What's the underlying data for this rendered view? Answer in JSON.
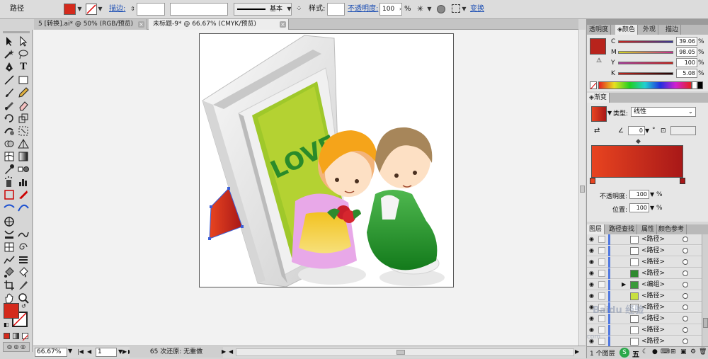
{
  "control_bar": {
    "object_type": "路径",
    "stroke_label": "描边:",
    "stroke_profile": "基本",
    "style_label": "样式:",
    "opacity_label": "不透明度:",
    "opacity_value": "100",
    "opacity_unit": "%",
    "transform_link": "变换",
    "fill_color": "#d42a1c"
  },
  "doc_tabs": [
    {
      "label": "5 [转换].ai* @ 50% (RGB/预览)",
      "active": false
    },
    {
      "label": "未标题-9* @ 66.67% (CMYK/预览)",
      "active": true
    }
  ],
  "artwork": {
    "frame_text": "LOVE",
    "colors": {
      "frame": "#e4e4e4",
      "card": "#b4d232",
      "text": "#2a8a2a",
      "selected_shape": "#e03a2a"
    }
  },
  "status": {
    "zoom": "66.67%",
    "page": "1",
    "undo_text": "65 次还原: 无重做"
  },
  "color_panel": {
    "tabs": [
      "透明度",
      "颜色",
      "外观",
      "描边"
    ],
    "active_tab": "颜色",
    "channels": [
      {
        "name": "C",
        "value": "39.06",
        "pct": "%",
        "fraction": 0.39
      },
      {
        "name": "M",
        "value": "98.05",
        "pct": "%",
        "fraction": 0.98
      },
      {
        "name": "Y",
        "value": "100",
        "pct": "%",
        "fraction": 1.0
      },
      {
        "name": "K",
        "value": "5.08",
        "pct": "%",
        "fraction": 0.05
      }
    ],
    "swatch_color": "#b8231c"
  },
  "gradient_panel": {
    "title": "渐变",
    "type_label": "类型:",
    "type_value": "线性",
    "angle_value": "0",
    "angle_unit": "°",
    "opacity_label": "不透明度:",
    "opacity_value": "100",
    "opacity_unit": "%",
    "location_label": "位置:",
    "location_value": "100",
    "location_unit": "%",
    "start_color": "#e84420",
    "end_color": "#a81818"
  },
  "layers_panel": {
    "tabs": [
      "图层",
      "路径查找",
      "属性",
      "颜色参考"
    ],
    "active_tab": "图层",
    "rows": [
      {
        "name": "<路径>",
        "thumb": "#ffffff"
      },
      {
        "name": "<路径>",
        "thumb": "#ffffff"
      },
      {
        "name": "<路径>",
        "thumb": "#ffffff"
      },
      {
        "name": "<路径>",
        "thumb": "#2e8a2e"
      },
      {
        "name": "<编组>",
        "thumb": "#3a9a3a",
        "expandable": true
      },
      {
        "name": "<路径>",
        "thumb": "#c8e040"
      },
      {
        "name": "<路径>",
        "thumb": "#ffffff"
      },
      {
        "name": "<路径>",
        "thumb": "#ffffff"
      },
      {
        "name": "<路径>",
        "thumb": "#ffffff"
      },
      {
        "name": "<路径>",
        "thumb": "#ffffff"
      }
    ],
    "footer": "1 个图层",
    "watermark": "jingyan.baidu.com",
    "ime_label": "五"
  }
}
